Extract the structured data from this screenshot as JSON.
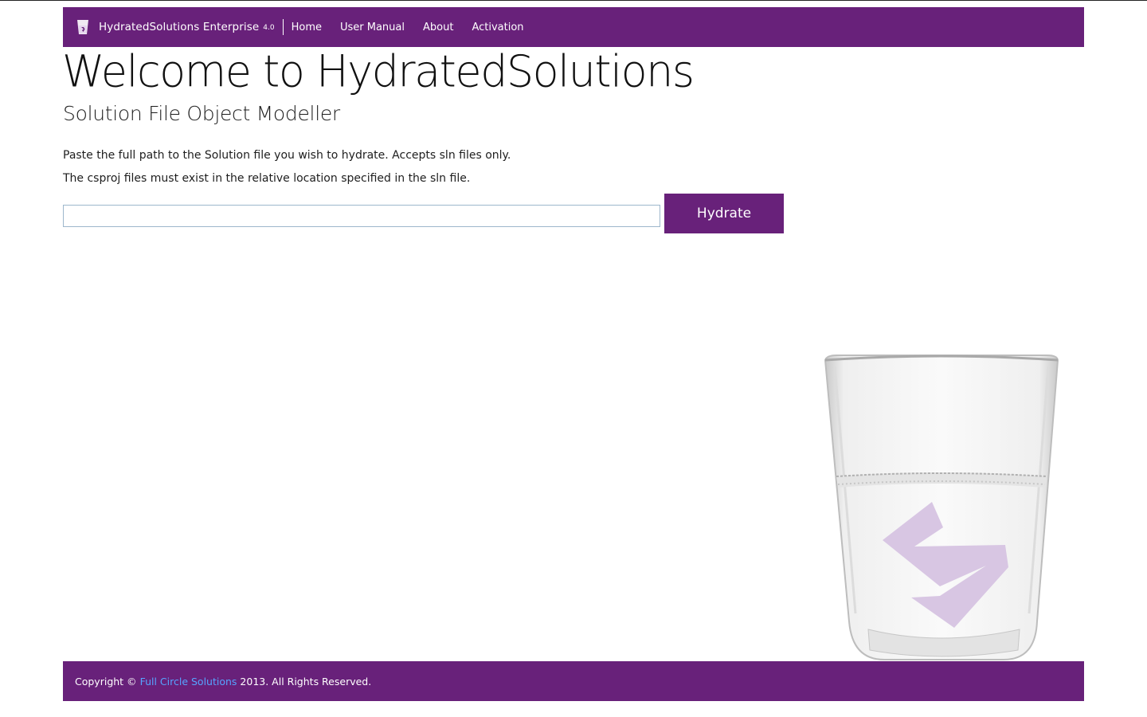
{
  "navbar": {
    "brand_name": "HydratedSolutions Enterprise",
    "brand_version": "4.0",
    "links": [
      {
        "label": "Home"
      },
      {
        "label": "User Manual"
      },
      {
        "label": "About"
      },
      {
        "label": "Activation"
      }
    ]
  },
  "main": {
    "title": "Welcome to HydratedSolutions",
    "subtitle": "Solution File Object Modeller",
    "instruction_1": "Paste the full path to the Solution file you wish to hydrate. Accepts sln files only.",
    "instruction_2": "The csproj files must exist in the relative location specified in the sln file.",
    "path_input_value": "",
    "hydrate_label": "Hydrate"
  },
  "footer": {
    "prefix": "Copyright ©",
    "link_text": "Full Circle Solutions",
    "suffix": "2013. All Rights Reserved."
  },
  "colors": {
    "brand_purple": "#68217a",
    "footer_link": "#56a4ff",
    "logo_tint": "#d8c6e3"
  }
}
